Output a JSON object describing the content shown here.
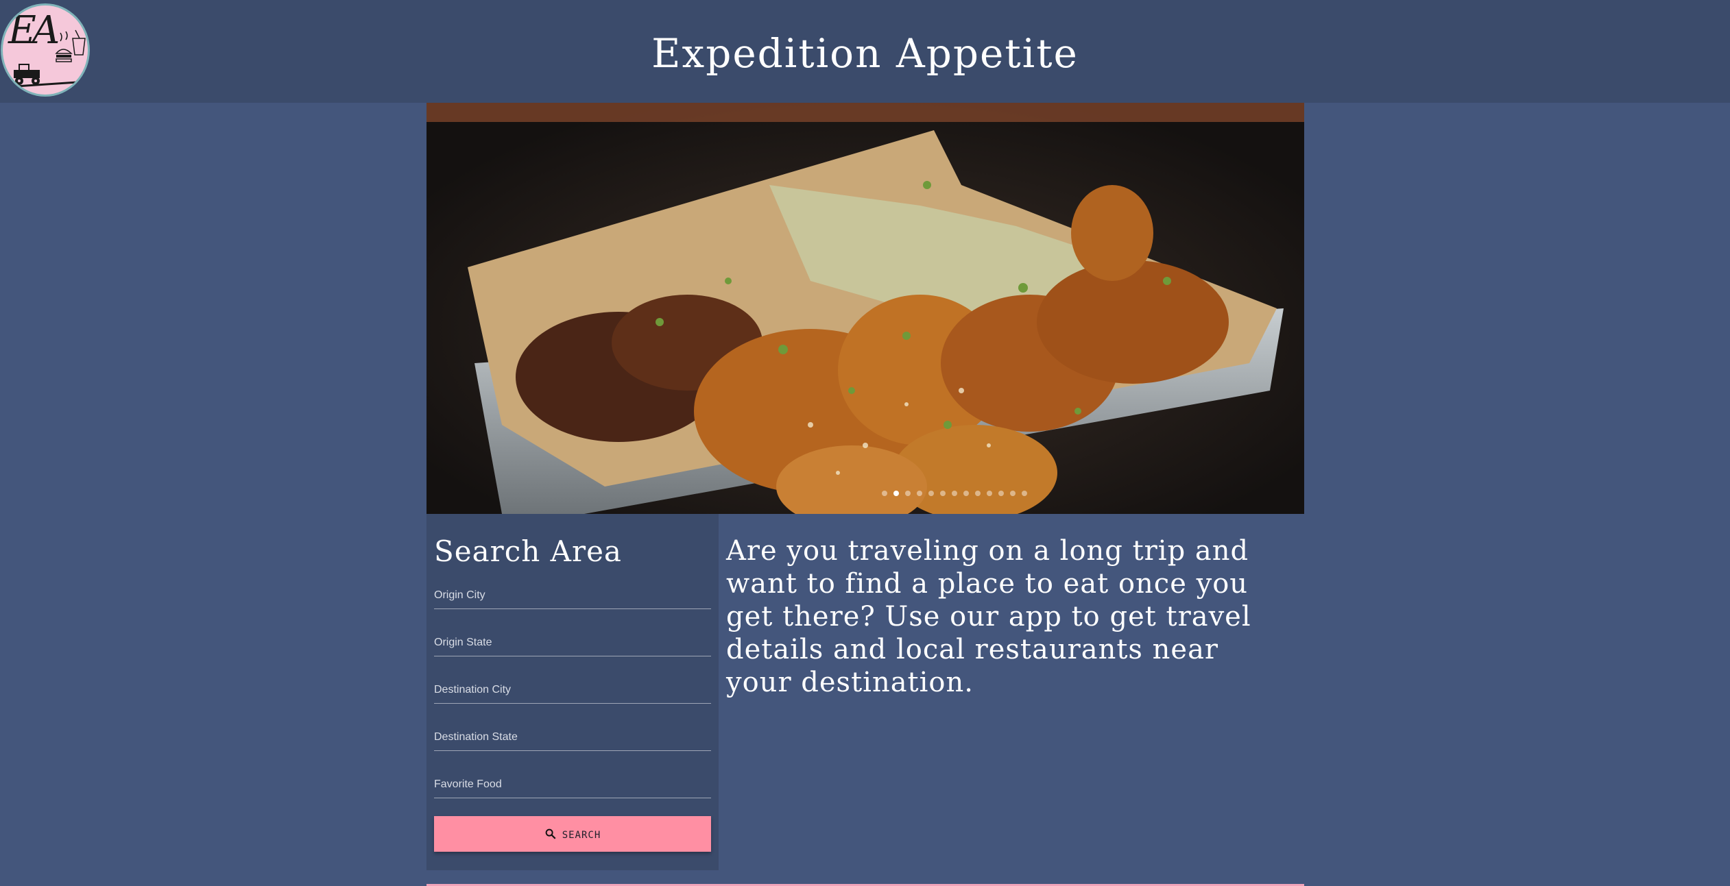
{
  "header": {
    "logo_text": "EA",
    "title": "Expedition Appetite"
  },
  "hero": {
    "dot_count": 13,
    "active_dot": 1
  },
  "search": {
    "title": "Search Area",
    "fields": [
      {
        "label": "Origin City"
      },
      {
        "label": "Origin State"
      },
      {
        "label": "Destination City"
      },
      {
        "label": "Destination State"
      },
      {
        "label": "Favorite Food"
      }
    ],
    "button_label": "SEARCH"
  },
  "intro": {
    "text": "Are you traveling on a long trip and want to find a place to eat once you get there? Use our app to get travel details and local restaurants near your destination."
  },
  "colors": {
    "page_background": "#44567c",
    "header_background": "#3b4b6b",
    "button": "#ff8fa3",
    "logo_background": "#f5c8da"
  }
}
